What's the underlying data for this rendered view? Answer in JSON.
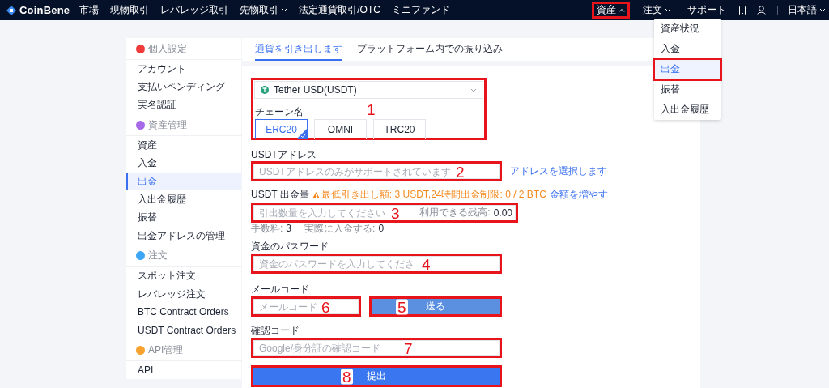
{
  "top_nav": {
    "logo": "CoinBene",
    "items": [
      {
        "label": "市場",
        "caret": false
      },
      {
        "label": "現物取引",
        "caret": false
      },
      {
        "label": "レバレッジ取引",
        "caret": false
      },
      {
        "label": "先物取引",
        "caret": true
      },
      {
        "label": "法定通貨取引/OTC",
        "caret": false
      },
      {
        "label": "ミニファンド",
        "caret": false
      }
    ],
    "right_items": [
      {
        "label": "資産",
        "expanded": true,
        "annotated": true
      },
      {
        "label": "注文",
        "expanded": false,
        "annotated": false
      },
      {
        "label": "サポート"
      }
    ],
    "language": "日本語"
  },
  "asset_menu": [
    {
      "label": "資産状況",
      "selected": false,
      "annotated": false
    },
    {
      "label": "入金",
      "selected": false,
      "annotated": false
    },
    {
      "label": "出金",
      "selected": true,
      "annotated": true
    },
    {
      "label": "振替",
      "selected": false,
      "annotated": false
    },
    {
      "label": "入出金履歴",
      "selected": false,
      "annotated": false
    }
  ],
  "sidebar": {
    "groups": [
      {
        "title": "個人設定",
        "color": "#ef3b3b",
        "items": [
          {
            "label": "アカウント",
            "selected": false
          },
          {
            "label": "支払いペンディング",
            "selected": false
          },
          {
            "label": "実名認証",
            "selected": false
          }
        ]
      },
      {
        "title": "資産管理",
        "color": "#a66ae8",
        "items": [
          {
            "label": "資産",
            "selected": false
          },
          {
            "label": "入金",
            "selected": false
          },
          {
            "label": "出金",
            "selected": true
          },
          {
            "label": "入出金履歴",
            "selected": false
          },
          {
            "label": "振替",
            "selected": false
          },
          {
            "label": "出金アドレスの管理",
            "selected": false
          }
        ]
      },
      {
        "title": "注文",
        "color": "#3aa6f5",
        "items": [
          {
            "label": "スポット注文",
            "selected": false
          },
          {
            "label": "レバレッジ注文",
            "selected": false
          },
          {
            "label": "BTC Contract Orders",
            "selected": false
          },
          {
            "label": "USDT Contract Orders",
            "selected": false
          }
        ]
      },
      {
        "title": "API管理",
        "color": "#f7a22e",
        "items": [
          {
            "label": "API",
            "selected": false
          }
        ]
      }
    ]
  },
  "tabs": [
    {
      "label": "通貨を引き出します",
      "selected": true
    },
    {
      "label": "プラットフォーム内での振り込み",
      "selected": false
    }
  ],
  "form": {
    "chain_block": {
      "currency": "Tether USD(USDT)",
      "label": "チェーン名",
      "annotation": "1",
      "chains": [
        {
          "label": "ERC20",
          "selected": true
        },
        {
          "label": "OMNI",
          "selected": false
        },
        {
          "label": "TRC20",
          "selected": false
        }
      ]
    },
    "address": {
      "label": "USDTアドレス",
      "placeholder": "USDTアドレスのみがサポートされています",
      "link": "アドレスを選択します",
      "annotation": "2"
    },
    "amount": {
      "label": "USDT 出金量",
      "notice": "最低引き出し額: 3 USDT,24時間出金制限: 0 / 2 BTC",
      "link": "金額を増やす",
      "placeholder": "引出数量を入力してください",
      "balance_label": "利用できる残高:",
      "balance_value": "0.00",
      "annotation": "3",
      "fee_label": "手数料:",
      "fee_value": "3",
      "received_label": "実際に入金する:",
      "received_value": "0"
    },
    "password": {
      "label": "資金のパスワード",
      "placeholder": "資金のパスワードを入力してくださ",
      "annotation": "4"
    },
    "email": {
      "label": "メールコード",
      "placeholder": "メールコード",
      "annotation": "6",
      "send_button": {
        "label": "送る",
        "annotation": "5"
      }
    },
    "verify": {
      "label": "確認コード",
      "placeholder": "Google/身分証の確認コード",
      "annotation": "7"
    },
    "submit": {
      "label": "提出",
      "annotation": "8"
    }
  }
}
